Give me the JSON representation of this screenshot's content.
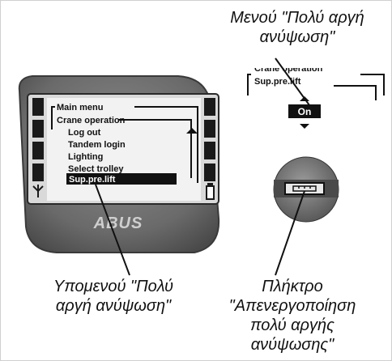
{
  "callouts": {
    "menu_title": [
      "Μενού \"Πολύ αργή",
      "ανύψωση\""
    ],
    "submenu_title": [
      "Υπομενού \"Πολύ",
      "αργή ανύψωση\""
    ],
    "key_title": [
      "Πλήκτρο",
      "\"Απενεργοποίηση",
      "πολύ αργής",
      "ανύψωσης\""
    ]
  },
  "display": {
    "header": "Main menu",
    "section": "Crane operation",
    "items": [
      "Log out",
      "Tandem login",
      "Lighting",
      "Select trolley"
    ],
    "selected_item": "Sup.pre.lift"
  },
  "brand": "ABUS",
  "zoom_panel": {
    "header_partial": "Crane operation",
    "item": "Sup.pre.lift",
    "value": "On"
  }
}
